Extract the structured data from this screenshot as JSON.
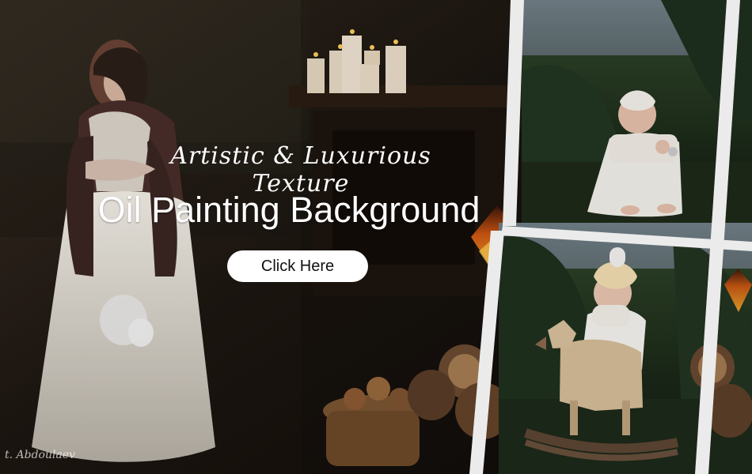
{
  "headline": {
    "script_line": "Artistic & Luxurious Texture",
    "main_line": "Oil Painting Background"
  },
  "cta": {
    "label": "Click Here"
  },
  "signature": {
    "text": "t. Abdoulaev"
  }
}
